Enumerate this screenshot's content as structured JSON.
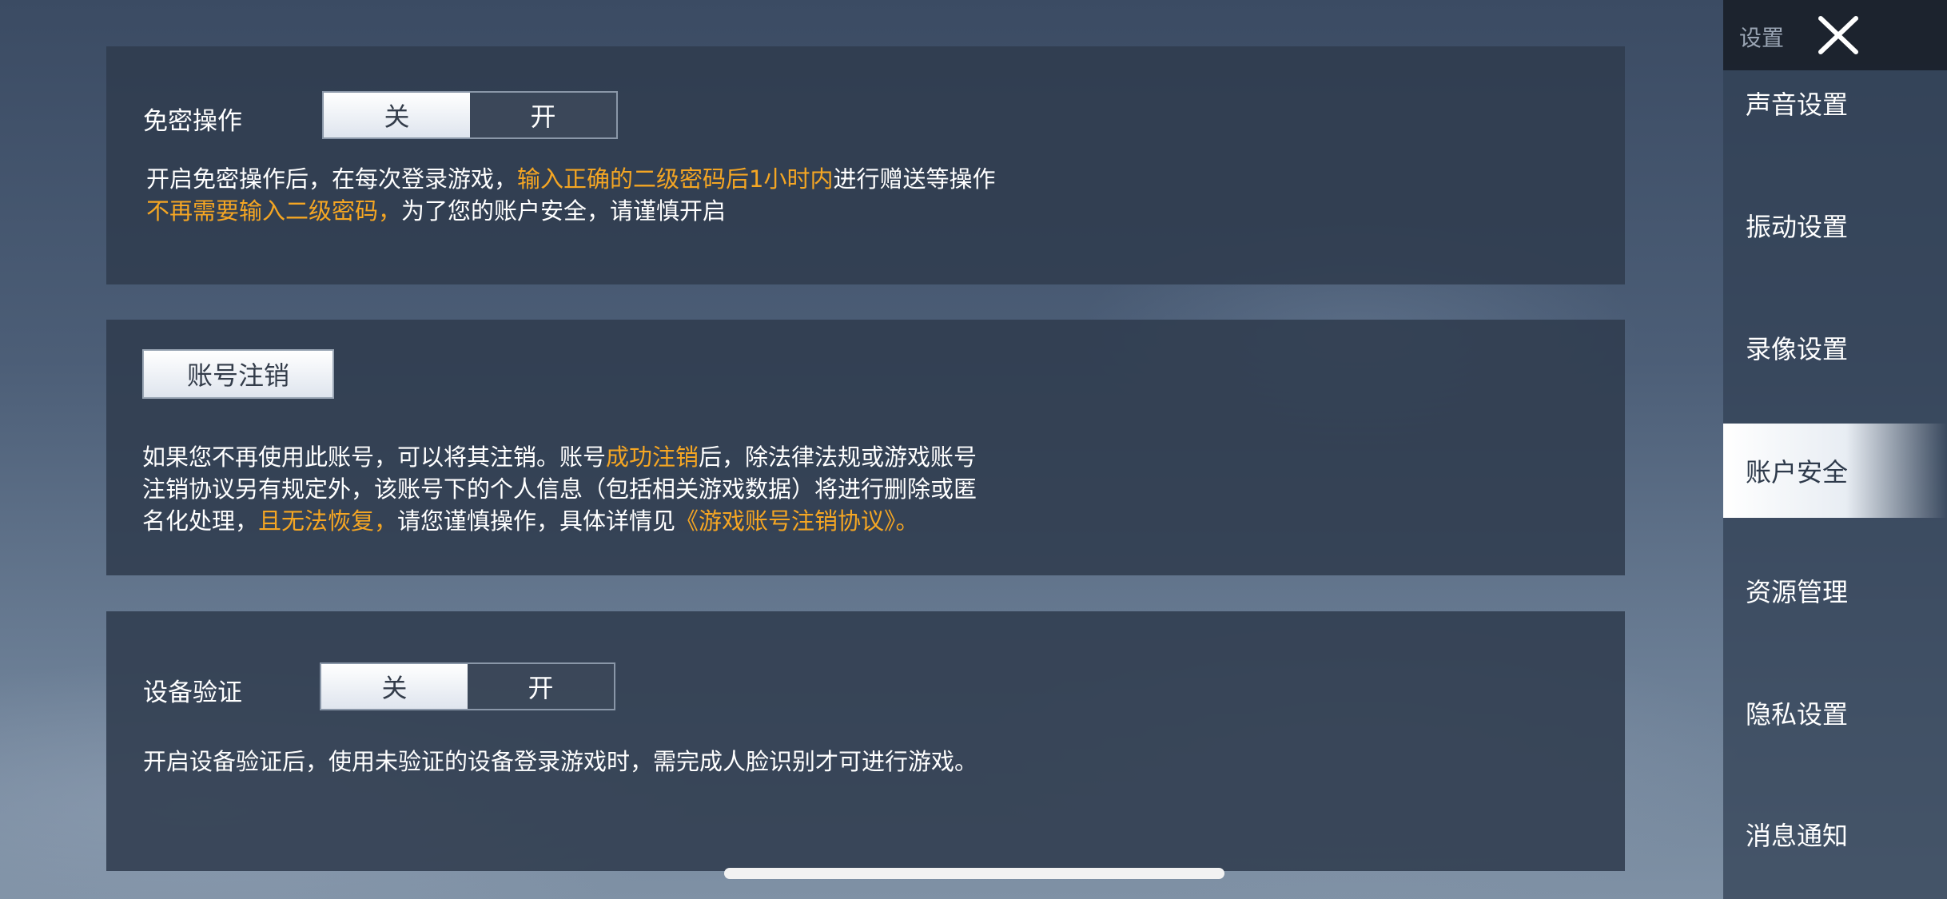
{
  "panels": {
    "password_free": {
      "label": "免密操作",
      "toggle": {
        "off": "关",
        "on": "开",
        "selected": "off"
      },
      "desc": {
        "line1_a": "开启免密操作后，在每次登录游戏，",
        "line1_b": "输入正确的二级密码后1小时内",
        "line1_c": "进行赠送等操作",
        "line2_a": "不再需要输入二级密码，",
        "line2_b": "为了您的账户安全，请谨慎开启"
      }
    },
    "account_cancel": {
      "button_label": "账号注销",
      "desc": {
        "line1_a": "如果您不再使用此账号，可以将其注销。账号",
        "line1_b": "成功注销",
        "line1_c": "后，除法律法规或游戏账号",
        "line2": "注销协议另有规定外，该账号下的个人信息（包括相关游戏数据）将进行删除或匿",
        "line3_a": "名化处理，",
        "line3_b": "且无法恢复，",
        "line3_c": "请您谨慎操作，具体详情见",
        "line3_d": "《游戏账号注销协议》。"
      }
    },
    "device_verify": {
      "label": "设备验证",
      "toggle": {
        "off": "关",
        "on": "开",
        "selected": "off"
      },
      "desc": "开启设备验证后，使用未验证的设备登录游戏时，需完成人脸识别才可进行游戏。"
    }
  },
  "sidebar": {
    "title": "设置",
    "items": [
      {
        "label": "声音设置"
      },
      {
        "label": "振动设置"
      },
      {
        "label": "录像设置"
      },
      {
        "label": "账户安全",
        "active": true
      },
      {
        "label": "资源管理"
      },
      {
        "label": "隐私设置"
      },
      {
        "label": "消息通知"
      }
    ]
  },
  "colors": {
    "highlight": "#f5a623",
    "panel_bg": "#303c4e"
  },
  "icons": {
    "close": "close-icon"
  }
}
